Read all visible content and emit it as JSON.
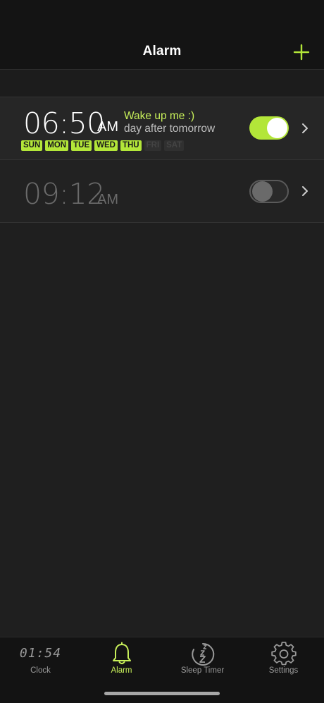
{
  "header": {
    "title": "Alarm",
    "add_icon": "plus-icon"
  },
  "alarms": [
    {
      "time": "06:50",
      "ampm": "AM",
      "label": "Wake up me :)",
      "subtitle": "day after tomorrow",
      "enabled": true,
      "days": [
        {
          "label": "SUN",
          "active": true
        },
        {
          "label": "MON",
          "active": true
        },
        {
          "label": "TUE",
          "active": true
        },
        {
          "label": "WED",
          "active": true
        },
        {
          "label": "THU",
          "active": true
        },
        {
          "label": "FRI",
          "active": false
        },
        {
          "label": "SAT",
          "active": false
        }
      ]
    },
    {
      "time": "09:12",
      "ampm": "AM",
      "enabled": false
    }
  ],
  "tabs": [
    {
      "label": "Clock",
      "icon": "digital-clock-icon",
      "active": false,
      "glyph": "01:54"
    },
    {
      "label": "Alarm",
      "icon": "bell-icon",
      "active": true
    },
    {
      "label": "Sleep Timer",
      "icon": "sleep-timer-icon",
      "active": false
    },
    {
      "label": "Settings",
      "icon": "gear-icon",
      "active": false
    }
  ],
  "colors": {
    "accent": "#b3e639",
    "background": "#1f1f1f"
  }
}
